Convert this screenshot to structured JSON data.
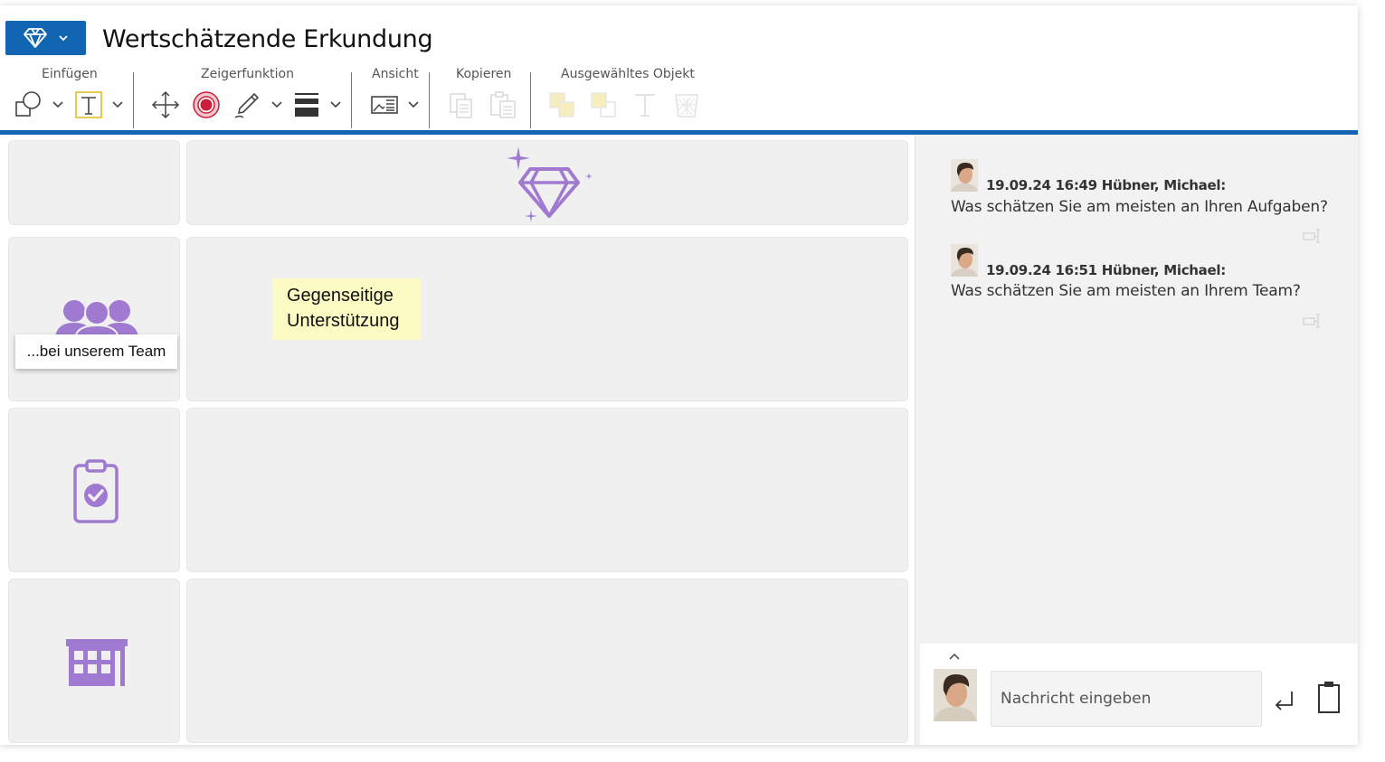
{
  "app": {
    "title": "Wertschätzende Erkundung",
    "accent_color": "#1265b0",
    "brand_icon": "diamond-icon"
  },
  "toolbar": {
    "groups": {
      "insert": "Einfügen",
      "pointer": "Zeigerfunktion",
      "view": "Ansicht",
      "copy": "Kopieren",
      "selected": "Ausgewähltes Objekt"
    }
  },
  "board": {
    "icon_color": "#a07ad0",
    "rows": [
      {
        "icon": "diamond-sparkle-icon"
      },
      {
        "icon": "team-icon",
        "card_label": "...bei unserem Team",
        "sticky_note": {
          "line1": "Gegenseitige",
          "line2": "Unterstützung",
          "color": "#fdfbc4"
        }
      },
      {
        "icon": "clipboard-check-icon"
      },
      {
        "icon": "building-icon"
      }
    ]
  },
  "chat": {
    "messages": [
      {
        "meta": "19.09.24 16:49 Hübner, Michael:",
        "text": "Was schätzen Sie am meisten an Ihren Aufgaben?"
      },
      {
        "meta": "19.09.24 16:51 Hübner, Michael:",
        "text": "Was schätzen Sie am meisten an Ihrem Team?"
      }
    ],
    "input_placeholder": "Nachricht eingeben"
  }
}
